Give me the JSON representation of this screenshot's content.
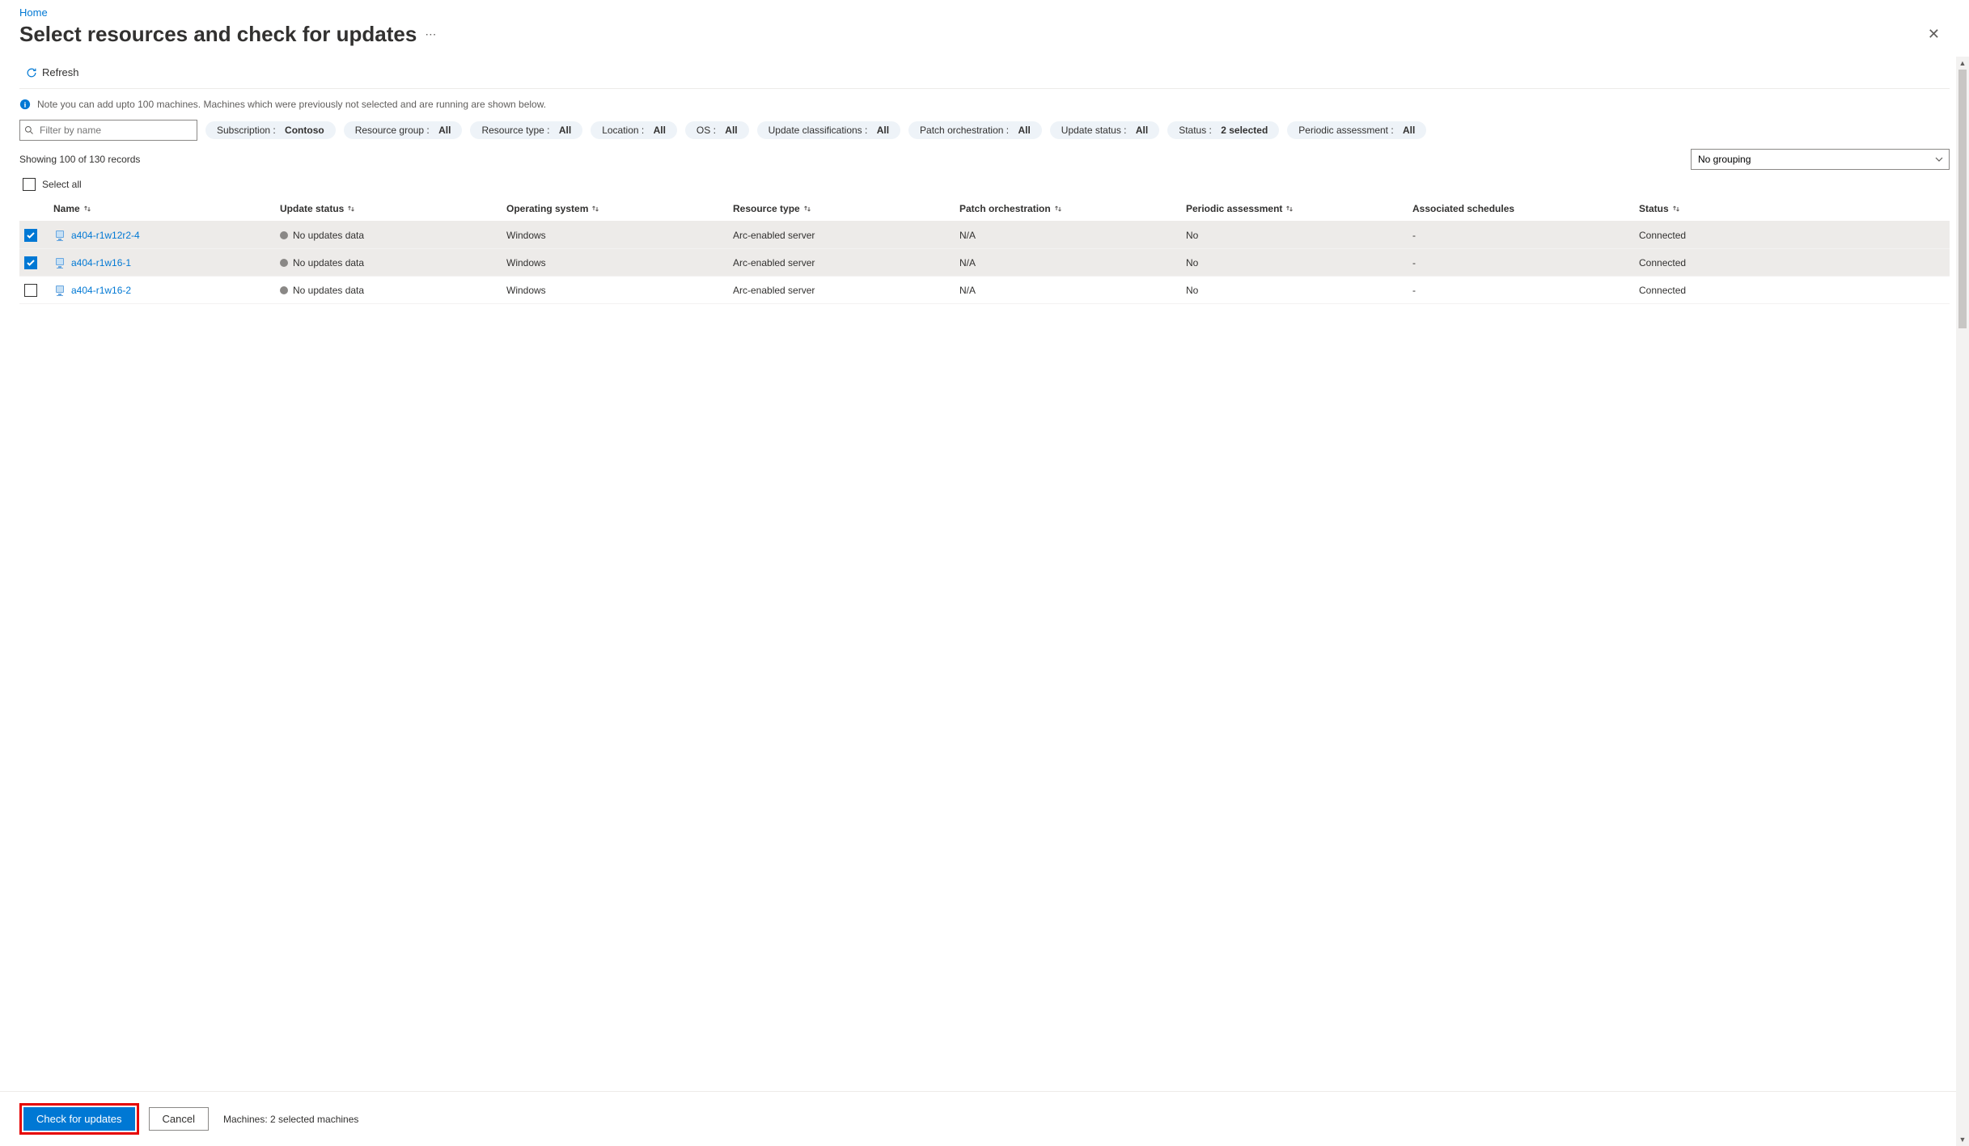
{
  "breadcrumb": {
    "home": "Home"
  },
  "header": {
    "title": "Select resources and check for updates"
  },
  "toolbar": {
    "refresh": "Refresh"
  },
  "note": "Note you can add upto 100 machines. Machines which were previously not selected and are running are shown below.",
  "filters": {
    "placeholder": "Filter by name",
    "subscription_label": "Subscription :",
    "subscription_value": "Contoso",
    "resource_group_label": "Resource group :",
    "resource_group_value": "All",
    "resource_type_label": "Resource type :",
    "resource_type_value": "All",
    "location_label": "Location :",
    "location_value": "All",
    "os_label": "OS :",
    "os_value": "All",
    "update_class_label": "Update classifications :",
    "update_class_value": "All",
    "patch_orch_label": "Patch orchestration :",
    "patch_orch_value": "All",
    "update_status_label": "Update status :",
    "update_status_value": "All",
    "status_label": "Status :",
    "status_value": "2 selected",
    "periodic_label": "Periodic assessment :",
    "periodic_value": "All"
  },
  "records_text": "Showing 100 of 130 records",
  "grouping": "No grouping",
  "select_all": "Select all",
  "columns": {
    "name": "Name",
    "update_status": "Update status",
    "os": "Operating system",
    "resource_type": "Resource type",
    "patch": "Patch orchestration",
    "periodic": "Periodic assessment",
    "schedules": "Associated schedules",
    "status": "Status"
  },
  "rows": [
    {
      "selected": true,
      "name": "a404-r1w12r2-4",
      "update_status": "No updates data",
      "os": "Windows",
      "resource_type": "Arc-enabled server",
      "patch": "N/A",
      "periodic": "No",
      "schedules": "-",
      "status": "Connected"
    },
    {
      "selected": true,
      "name": "a404-r1w16-1",
      "update_status": "No updates data",
      "os": "Windows",
      "resource_type": "Arc-enabled server",
      "patch": "N/A",
      "periodic": "No",
      "schedules": "-",
      "status": "Connected"
    },
    {
      "selected": false,
      "name": "a404-r1w16-2",
      "update_status": "No updates data",
      "os": "Windows",
      "resource_type": "Arc-enabled server",
      "patch": "N/A",
      "periodic": "No",
      "schedules": "-",
      "status": "Connected"
    }
  ],
  "footer": {
    "check": "Check for updates",
    "cancel": "Cancel",
    "status": "Machines: 2 selected machines"
  }
}
